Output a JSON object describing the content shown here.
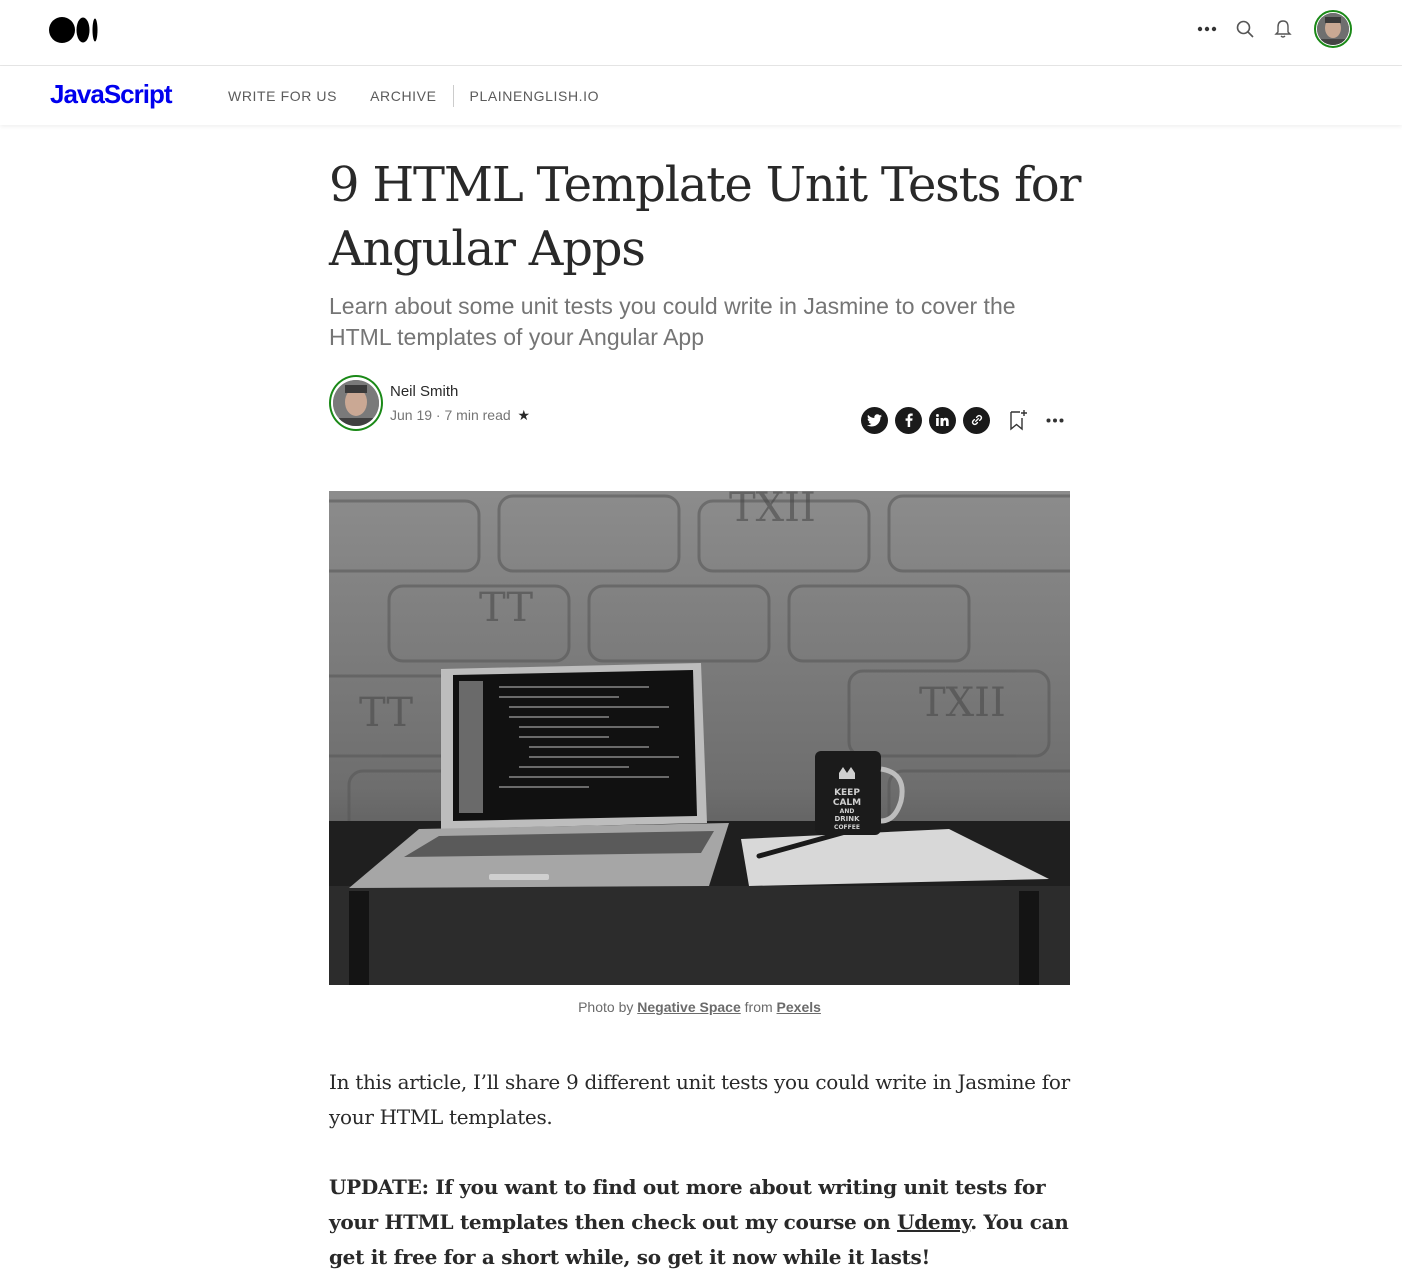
{
  "header": {
    "more_icon": "more-dots-icon",
    "search_icon": "search-icon",
    "bell_icon": "bell-icon"
  },
  "publication": {
    "name": "JavaScript",
    "nav": [
      "WRITE FOR US",
      "ARCHIVE",
      "PLAINENGLISH.IO"
    ]
  },
  "article": {
    "title": "9 HTML Template Unit Tests for Angular Apps",
    "subtitle": "Learn about some unit tests you could write in Jasmine to cover the HTML templates of your Angular App",
    "author": "Neil Smith",
    "date": "Jun 19",
    "read_time": "7 min read",
    "star": "★",
    "caption": {
      "prefix": "Photo by",
      "photographer": "Negative Space",
      "middle": "from",
      "source": "Pexels"
    },
    "paragraph1": "In this article, I’ll share 9 different unit tests you could write in Jasmine for your HTML templates.",
    "paragraph2_start": "UPDATE: If you want to find out more about writing unit tests for your HTML templates then check out my course on",
    "paragraph2_link": "Udemy",
    "paragraph2_end": ". You can get it free for a short while, so get it now while it lasts!"
  },
  "colors": {
    "accent_green": "#1a8917",
    "publication_blue": "#0000ee"
  }
}
